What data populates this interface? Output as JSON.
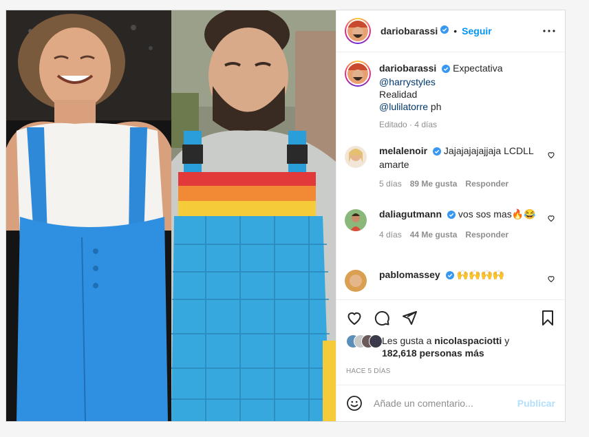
{
  "post": {
    "author": "dariobarassi",
    "follow_label": "Seguir",
    "caption": {
      "line1": "Expectativa",
      "mention1": "@harrystyles",
      "line2": "Realidad",
      "mention2": "@lulilatorre",
      "suffix": " ph",
      "meta": "Editado · 4 días"
    }
  },
  "comments": [
    {
      "user": "melalenoir",
      "text": "Jajajajajajjaja LCDLL amarte",
      "age": "5 días",
      "likes": "89 Me gusta",
      "reply": "Responder"
    },
    {
      "user": "daliagutmann",
      "text": "vos sos mas🔥😂",
      "age": "4 días",
      "likes": "44 Me gusta",
      "reply": "Responder"
    },
    {
      "user": "pablomassey",
      "text": "🙌🙌🙌🙌"
    }
  ],
  "likes": {
    "prefix": "Les gusta a ",
    "user": "nicolaspaciotti",
    "middle": " y",
    "count": "182,618 personas más"
  },
  "timestamp": "HACE 5 DÍAS",
  "comment_box": {
    "placeholder": "Añade un comentario...",
    "publish": "Publicar"
  },
  "colors": {
    "link": "#0095f6",
    "mention": "#00376b",
    "muted": "#8e8e8e",
    "publish_disabled": "#b2dffc"
  },
  "icons": [
    "more-icon",
    "verified-icon",
    "heart-icon",
    "comment-icon",
    "share-icon",
    "bookmark-icon",
    "emoji-icon"
  ]
}
